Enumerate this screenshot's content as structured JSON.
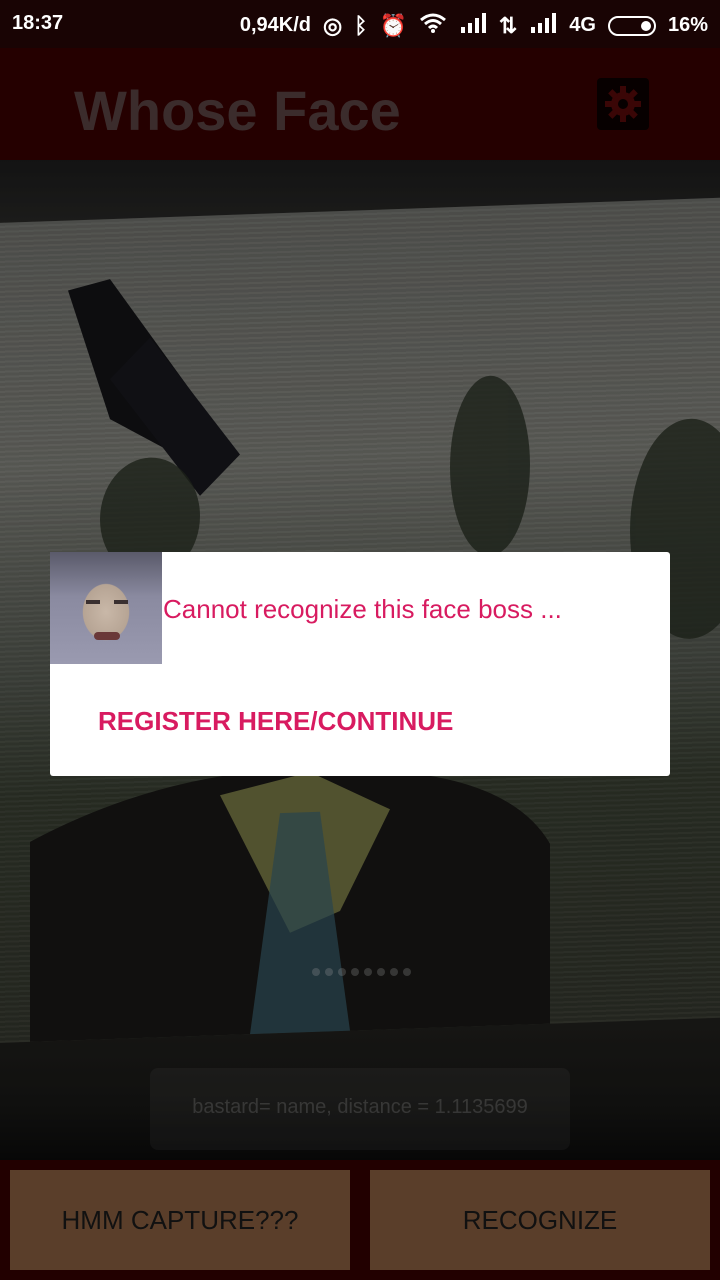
{
  "status_bar": {
    "time": "18:37",
    "data_speed": "0,94K/d",
    "network": "4G",
    "battery": "16%",
    "icons": [
      "hotspot-icon",
      "bluetooth-icon",
      "alarm-icon",
      "wifi-icon",
      "signal-icon",
      "data-arrows-icon",
      "signal-icon",
      "battery-icon"
    ]
  },
  "app_bar": {
    "title": "Whose Face",
    "settings_icon": "gear-icon"
  },
  "camera": {
    "debug_toast": "bastard= name, distance = 1.1135699"
  },
  "dialog": {
    "message": "Cannot recognize this face boss ...",
    "action_label": "REGISTER HERE/CONTINUE"
  },
  "buttons": {
    "capture_label": "HMM CAPTURE???",
    "recognize_label": "RECOGNIZE"
  },
  "colors": {
    "accent": "#d81b60",
    "app_bar": "#3a0000",
    "button_bg": "#5a3e2a"
  }
}
